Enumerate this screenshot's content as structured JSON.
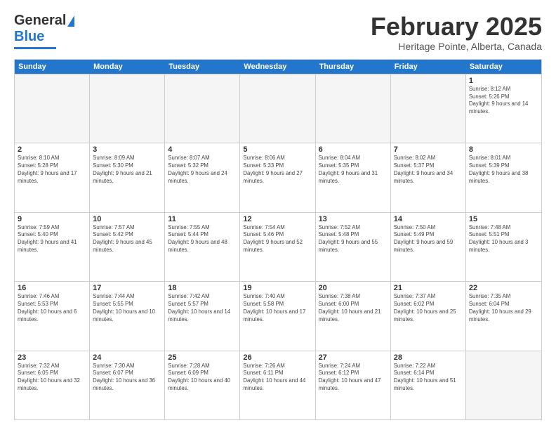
{
  "logo": {
    "line1": "General",
    "line2": "Blue"
  },
  "title": {
    "month_year": "February 2025",
    "location": "Heritage Pointe, Alberta, Canada"
  },
  "days_of_week": [
    "Sunday",
    "Monday",
    "Tuesday",
    "Wednesday",
    "Thursday",
    "Friday",
    "Saturday"
  ],
  "weeks": [
    [
      {
        "day": "",
        "info": ""
      },
      {
        "day": "",
        "info": ""
      },
      {
        "day": "",
        "info": ""
      },
      {
        "day": "",
        "info": ""
      },
      {
        "day": "",
        "info": ""
      },
      {
        "day": "",
        "info": ""
      },
      {
        "day": "1",
        "info": "Sunrise: 8:12 AM\nSunset: 5:26 PM\nDaylight: 9 hours and 14 minutes."
      }
    ],
    [
      {
        "day": "2",
        "info": "Sunrise: 8:10 AM\nSunset: 5:28 PM\nDaylight: 9 hours and 17 minutes."
      },
      {
        "day": "3",
        "info": "Sunrise: 8:09 AM\nSunset: 5:30 PM\nDaylight: 9 hours and 21 minutes."
      },
      {
        "day": "4",
        "info": "Sunrise: 8:07 AM\nSunset: 5:32 PM\nDaylight: 9 hours and 24 minutes."
      },
      {
        "day": "5",
        "info": "Sunrise: 8:06 AM\nSunset: 5:33 PM\nDaylight: 9 hours and 27 minutes."
      },
      {
        "day": "6",
        "info": "Sunrise: 8:04 AM\nSunset: 5:35 PM\nDaylight: 9 hours and 31 minutes."
      },
      {
        "day": "7",
        "info": "Sunrise: 8:02 AM\nSunset: 5:37 PM\nDaylight: 9 hours and 34 minutes."
      },
      {
        "day": "8",
        "info": "Sunrise: 8:01 AM\nSunset: 5:39 PM\nDaylight: 9 hours and 38 minutes."
      }
    ],
    [
      {
        "day": "9",
        "info": "Sunrise: 7:59 AM\nSunset: 5:40 PM\nDaylight: 9 hours and 41 minutes."
      },
      {
        "day": "10",
        "info": "Sunrise: 7:57 AM\nSunset: 5:42 PM\nDaylight: 9 hours and 45 minutes."
      },
      {
        "day": "11",
        "info": "Sunrise: 7:55 AM\nSunset: 5:44 PM\nDaylight: 9 hours and 48 minutes."
      },
      {
        "day": "12",
        "info": "Sunrise: 7:54 AM\nSunset: 5:46 PM\nDaylight: 9 hours and 52 minutes."
      },
      {
        "day": "13",
        "info": "Sunrise: 7:52 AM\nSunset: 5:48 PM\nDaylight: 9 hours and 55 minutes."
      },
      {
        "day": "14",
        "info": "Sunrise: 7:50 AM\nSunset: 5:49 PM\nDaylight: 9 hours and 59 minutes."
      },
      {
        "day": "15",
        "info": "Sunrise: 7:48 AM\nSunset: 5:51 PM\nDaylight: 10 hours and 3 minutes."
      }
    ],
    [
      {
        "day": "16",
        "info": "Sunrise: 7:46 AM\nSunset: 5:53 PM\nDaylight: 10 hours and 6 minutes."
      },
      {
        "day": "17",
        "info": "Sunrise: 7:44 AM\nSunset: 5:55 PM\nDaylight: 10 hours and 10 minutes."
      },
      {
        "day": "18",
        "info": "Sunrise: 7:42 AM\nSunset: 5:57 PM\nDaylight: 10 hours and 14 minutes."
      },
      {
        "day": "19",
        "info": "Sunrise: 7:40 AM\nSunset: 5:58 PM\nDaylight: 10 hours and 17 minutes."
      },
      {
        "day": "20",
        "info": "Sunrise: 7:38 AM\nSunset: 6:00 PM\nDaylight: 10 hours and 21 minutes."
      },
      {
        "day": "21",
        "info": "Sunrise: 7:37 AM\nSunset: 6:02 PM\nDaylight: 10 hours and 25 minutes."
      },
      {
        "day": "22",
        "info": "Sunrise: 7:35 AM\nSunset: 6:04 PM\nDaylight: 10 hours and 29 minutes."
      }
    ],
    [
      {
        "day": "23",
        "info": "Sunrise: 7:32 AM\nSunset: 6:05 PM\nDaylight: 10 hours and 32 minutes."
      },
      {
        "day": "24",
        "info": "Sunrise: 7:30 AM\nSunset: 6:07 PM\nDaylight: 10 hours and 36 minutes."
      },
      {
        "day": "25",
        "info": "Sunrise: 7:28 AM\nSunset: 6:09 PM\nDaylight: 10 hours and 40 minutes."
      },
      {
        "day": "26",
        "info": "Sunrise: 7:26 AM\nSunset: 6:11 PM\nDaylight: 10 hours and 44 minutes."
      },
      {
        "day": "27",
        "info": "Sunrise: 7:24 AM\nSunset: 6:12 PM\nDaylight: 10 hours and 47 minutes."
      },
      {
        "day": "28",
        "info": "Sunrise: 7:22 AM\nSunset: 6:14 PM\nDaylight: 10 hours and 51 minutes."
      },
      {
        "day": "",
        "info": ""
      }
    ]
  ]
}
